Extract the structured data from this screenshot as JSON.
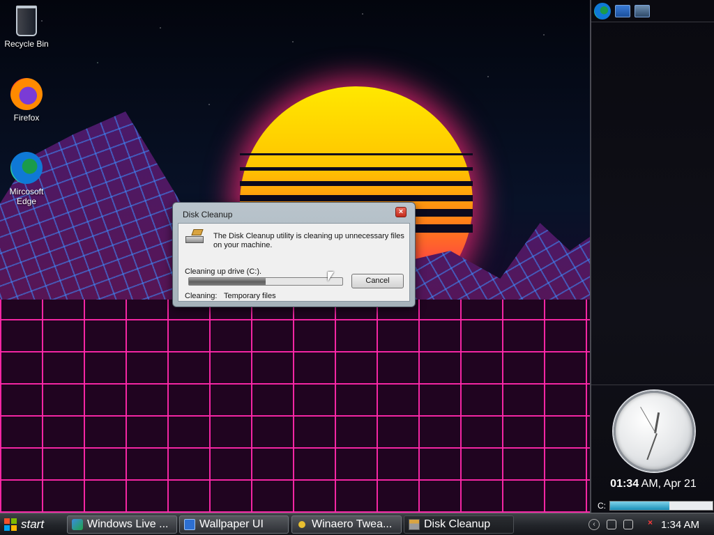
{
  "desktop": {
    "icons": [
      {
        "label": "Recycle Bin",
        "icon": "recycle-bin-icon"
      },
      {
        "label": "Firefox",
        "icon": "firefox-icon"
      },
      {
        "label": "Mircosoft\nEdge",
        "icon": "edge-icon"
      }
    ]
  },
  "dialog": {
    "title": "Disk Cleanup",
    "close_symbol": "×",
    "message": "The Disk Cleanup utility is cleaning up unnecessary files on your machine.",
    "drive_text": "Cleaning up drive  (C:).",
    "progress_fraction": 0.5,
    "cancel_label": "Cancel",
    "cleaning_label": "Cleaning:",
    "cleaning_value": "Temporary files"
  },
  "sidebar": {
    "toolbar_icons": [
      "edge-icon",
      "screen-icon",
      "windows-icon"
    ],
    "clock_time": "01:34",
    "clock_suffix": " AM, Apr 21",
    "drive_label": "C:",
    "drive_usage_fraction": 0.58
  },
  "taskbar": {
    "start_label": "start",
    "buttons": [
      {
        "label": "Windows Live ...",
        "icon": "windows-live-icon"
      },
      {
        "label": "Wallpaper UI",
        "icon": "wallpaper-icon"
      },
      {
        "label": "Winaero Twea...",
        "icon": "winaero-icon"
      },
      {
        "label": "Disk Cleanup",
        "icon": "disk-cleanup-icon",
        "active": true
      }
    ],
    "tray_time": "1:34 AM"
  },
  "colors": {
    "accent_pink": "#ff28aa",
    "sun_yellow": "#ffe800",
    "taskbar": "#22252a"
  }
}
